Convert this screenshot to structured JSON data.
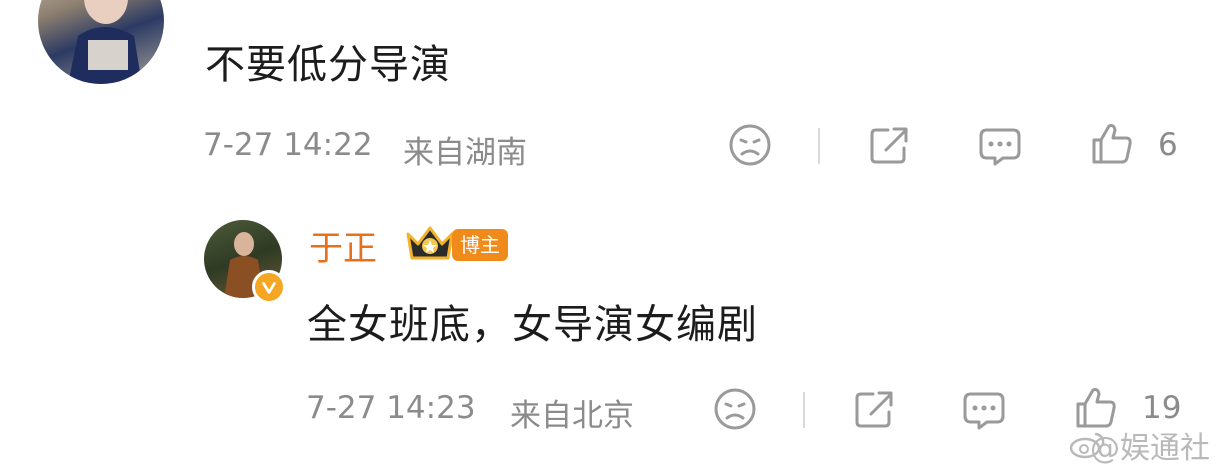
{
  "comments": [
    {
      "text": "不要低分导演",
      "time": "7-27 14:22",
      "location": "来自湖南",
      "likes": "6"
    },
    {
      "author": "于正",
      "badge": "博主",
      "text": "全女班底，女导演女编剧",
      "time": "7-27 14:23",
      "location": "来自北京",
      "likes": "19"
    }
  ],
  "watermark": "@娱通社",
  "colors": {
    "author": "#e8701a",
    "badge_bg": "#f08a1a",
    "meta": "#8b8b8b",
    "icon": "#9a9a9a"
  }
}
